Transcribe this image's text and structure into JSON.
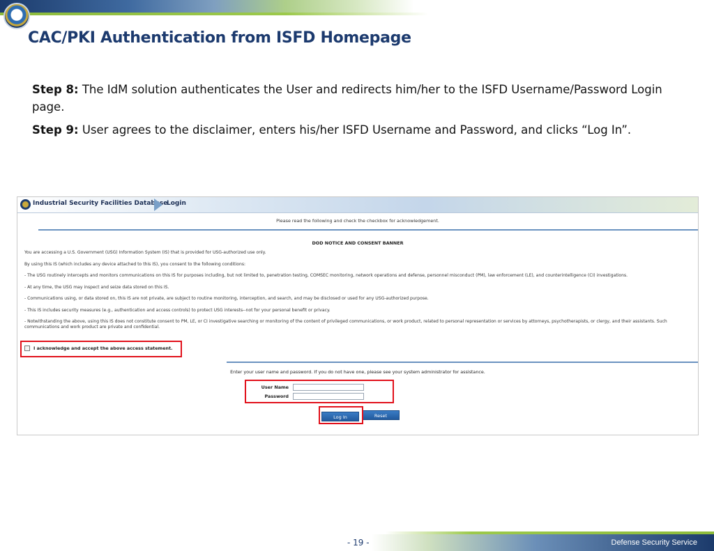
{
  "slide": {
    "title": "CAC/PKI Authentication from ISFD Homepage",
    "page_number": "- 19 -",
    "footer_org": "Defense Security Service"
  },
  "steps": [
    {
      "label": "Step 8:",
      "text": " The IdM solution authenticates the User and redirects him/her to the ISFD Username/Password Login page."
    },
    {
      "label": "Step 9:",
      "text": " User agrees to the disclaimer, enters his/her ISFD Username and Password, and clicks “Log In”."
    }
  ],
  "screenshot": {
    "app_title": "Industrial Security Facilities Database",
    "page_label": "Login",
    "instruction": "Please read the following and check the checkbox for acknowledgement.",
    "banner_title": "DOD NOTICE AND CONSENT BANNER",
    "consent_lines": [
      "You are accessing a U.S. Government (USG) Information System (IS) that is provided for USG-authorized use only.",
      "By using this IS (which includes any device attached to this IS), you consent to the following conditions:",
      "- The USG routinely intercepts and monitors communications on this IS for purposes including, but not limited to, penetration testing, COMSEC monitoring, network operations and defense, personnel misconduct (PM), law enforcement (LE), and counterintelligence (CI) investigations.",
      "- At any time, the USG may inspect and seize data stored on this IS.",
      "- Communications using, or data stored on, this IS are not private, are subject to routine monitoring, interception, and search, and may be disclosed or used for any USG-authorized purpose.",
      "- This IS includes security measures (e.g., authentication and access controls) to protect USG interests--not for your personal benefit or privacy.",
      "- Notwithstanding the above, using this IS does not constitute consent to PM, LE, or CI investigative searching or monitoring of the content of privileged communications, or work product, related to personal representation or services by attorneys, psychotherapists, or clergy, and their assistants. Such communications and work product are private and confidential."
    ],
    "acknowledge_label": "I acknowledge and accept the above access statement.",
    "login_instruction": "Enter your user name and password. If you do not have one, please see your system administrator for assistance.",
    "username_label": "User Name",
    "password_label": "Password",
    "username_value": "",
    "password_value": "",
    "login_button": "Log In",
    "reset_button": "Reset"
  },
  "colors": {
    "title": "#1c3a6e",
    "highlight": "#e1101a",
    "button": "#225a9e",
    "accent_green": "#8dbb3c"
  }
}
